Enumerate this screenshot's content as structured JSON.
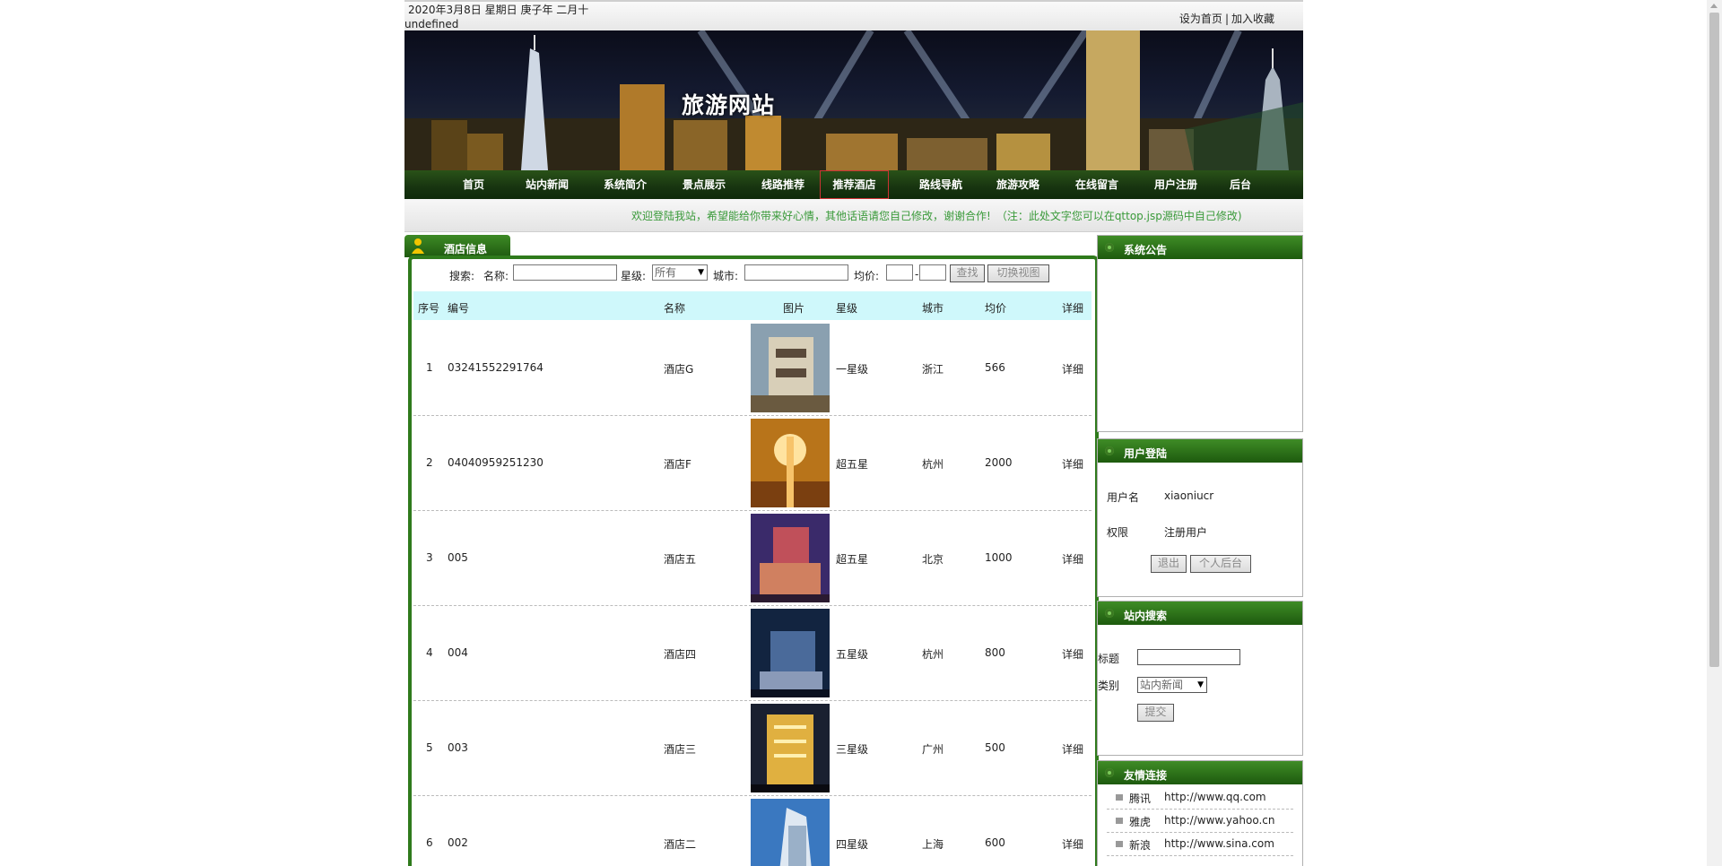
{
  "topbar": {
    "date": "2020年3月8日 星期日 庚子年 二月十",
    "undefined_text": "undefined",
    "set_home": "设为首页",
    "separator": "|",
    "add_favorite": "加入收藏"
  },
  "banner": {
    "title": "旅游网站"
  },
  "nav": {
    "items": [
      "首页",
      "站内新闻",
      "系统简介",
      "景点展示",
      "线路推荐",
      "推荐酒店",
      "路线导航",
      "旅游攻略",
      "在线留言",
      "用户注册",
      "后台"
    ],
    "active": "推荐酒店"
  },
  "marquee": {
    "text": "欢迎登陆我站，希望能给你带来好心情，其他话语请您自己修改，谢谢合作!　（注：此处文字您可以在qttop.jsp源码中自己修改)"
  },
  "hotel": {
    "tab_label": "酒店信息",
    "search": {
      "label_search": "搜索:",
      "label_name": "名称:",
      "label_star": "星级:",
      "star_value": "所有",
      "label_city": "城市:",
      "label_price": "均价:",
      "price_sep": "-",
      "find_button": "查找",
      "switch_button": "切换视图"
    },
    "columns": [
      "序号",
      "编号",
      "名称",
      "图片",
      "星级",
      "城市",
      "均价",
      "详细"
    ],
    "rows": [
      {
        "idx": "1",
        "code": "03241552291764",
        "name": "酒店G",
        "star": "一星级",
        "city": "浙江",
        "price": "566",
        "detail": "详细"
      },
      {
        "idx": "2",
        "code": "04040959251230",
        "name": "酒店F",
        "star": "超五星",
        "city": "杭州",
        "price": "2000",
        "detail": "详细"
      },
      {
        "idx": "3",
        "code": "005",
        "name": "酒店五",
        "star": "超五星",
        "city": "北京",
        "price": "1000",
        "detail": "详细"
      },
      {
        "idx": "4",
        "code": "004",
        "name": "酒店四",
        "star": "五星级",
        "city": "杭州",
        "price": "800",
        "detail": "详细"
      },
      {
        "idx": "5",
        "code": "003",
        "name": "酒店三",
        "star": "三星级",
        "city": "广州",
        "price": "500",
        "detail": "详细"
      },
      {
        "idx": "6",
        "code": "002",
        "name": "酒店二",
        "star": "四星级",
        "city": "上海",
        "price": "600",
        "detail": "详细"
      }
    ]
  },
  "sidebar": {
    "notice_title": "系统公告",
    "login": {
      "title": "用户登陆",
      "username_label": "用户名",
      "username_value": "xiaoniucr",
      "role_label": "权限",
      "role_value": "注册用户",
      "logout_button": "退出",
      "personal_button": "个人后台"
    },
    "site_search": {
      "title": "站内搜索",
      "title_label": "标题",
      "category_label": "类别",
      "category_value": "站内新闻",
      "submit_button": "提交"
    },
    "friend_links": {
      "title": "友情连接",
      "items": [
        {
          "name": "腾讯",
          "url": "http://www.qq.com"
        },
        {
          "name": "雅虎",
          "url": "http://www.yahoo.cn"
        },
        {
          "name": "新浪",
          "url": "http://www.sina.com"
        }
      ]
    }
  }
}
